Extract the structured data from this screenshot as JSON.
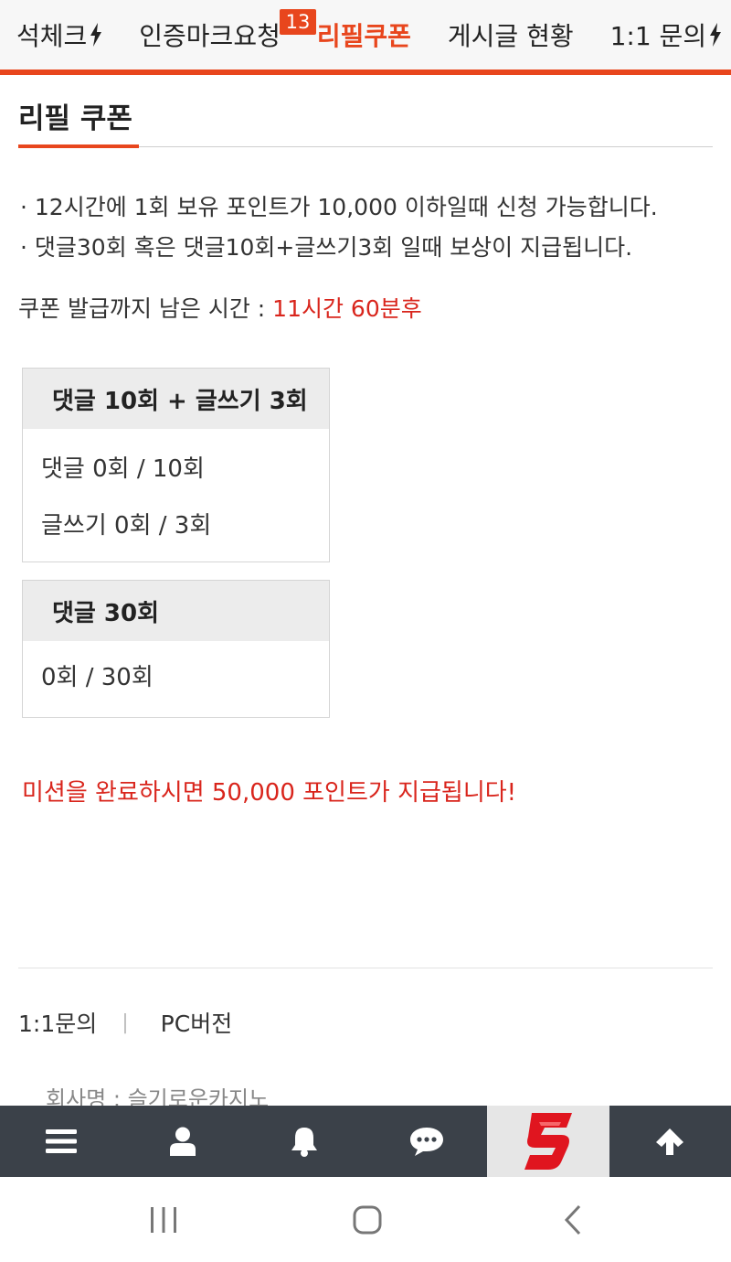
{
  "topnav": {
    "tabs": [
      {
        "label": "석체크",
        "bolt": true,
        "active": false
      },
      {
        "label": "인증마크요청",
        "bolt": false,
        "active": false
      },
      {
        "label": "리필쿠폰",
        "bolt": false,
        "active": true
      },
      {
        "label": "게시글 현황",
        "bolt": false,
        "active": false
      },
      {
        "label": "1:1 문의",
        "bolt": true,
        "active": false
      }
    ]
  },
  "page": {
    "title": "리필 쿠폰",
    "notes": [
      "· 12시간에 1회 보유 포인트가 10,000 이하일때 신청 가능합니다.",
      "· 댓글30회 혹은 댓글10회+글쓰기3회 일때 보상이 지급됩니다."
    ],
    "timer_label": "쿠폰 발급까지 남은 시간 : ",
    "timer_value": "11시간 60분후"
  },
  "missions": [
    {
      "title": "댓글 10회 + 글쓰기 3회",
      "rows": [
        "댓글 0회 / 10회",
        "글쓰기 0회 / 3회"
      ]
    },
    {
      "title": "댓글 30회",
      "rows": [
        "0회 / 30회"
      ]
    }
  ],
  "reward_text": "미션을 완료하시면 50,000 포인트가 지급됩니다!",
  "footer": {
    "links": [
      "1:1문의",
      "PC버전"
    ],
    "separator": "|",
    "company": "회사명 : 슬기로운카지노"
  },
  "appbar": {
    "notification_count": "13",
    "icons": [
      "menu-icon",
      "user-icon",
      "bell-icon",
      "chat-icon",
      "site-logo",
      "arrow-up-icon"
    ]
  },
  "colors": {
    "accent": "#e8461d",
    "highlight_text": "#d9251c",
    "appbar_bg": "#3b4149"
  }
}
